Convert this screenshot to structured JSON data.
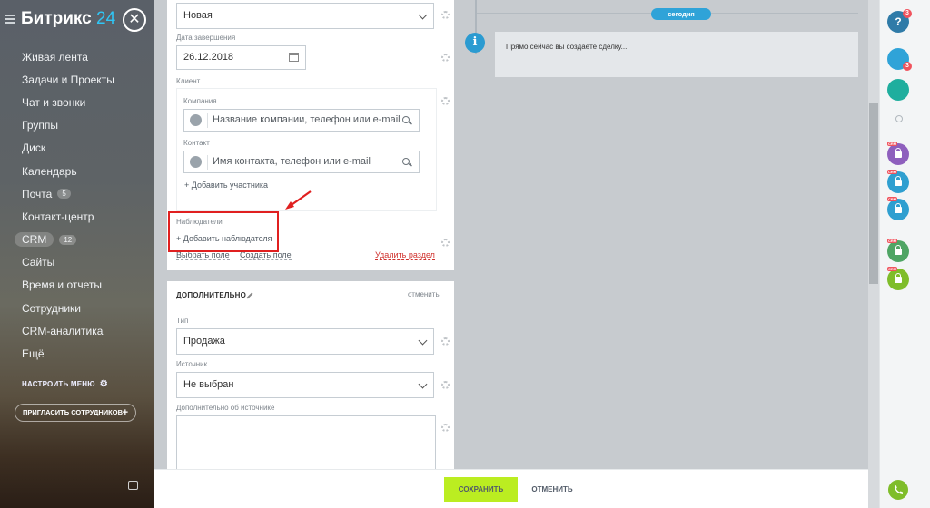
{
  "sidebar": {
    "brand_name": "Битрикс",
    "brand_num": "24",
    "items": [
      {
        "label": "Живая лента"
      },
      {
        "label": "Задачи и Проекты"
      },
      {
        "label": "Чат и звонки"
      },
      {
        "label": "Группы"
      },
      {
        "label": "Диск"
      },
      {
        "label": "Календарь"
      },
      {
        "label": "Почта",
        "count": "5"
      },
      {
        "label": "Контакт-центр"
      },
      {
        "label": "CRM",
        "count": "12"
      },
      {
        "label": "Сайты"
      },
      {
        "label": "Время и отчеты"
      },
      {
        "label": "Сотрудники"
      },
      {
        "label": "CRM-аналитика"
      },
      {
        "label": "Ещё"
      }
    ],
    "setup_menu": "НАСТРОИТЬ МЕНЮ",
    "invite": "ПРИГЛАСИТЬ СОТРУДНИКОВ"
  },
  "form": {
    "stage_value": "Новая",
    "end_date_label": "Дата завершения",
    "end_date_value": "26.12.2018",
    "client_label": "Клиент",
    "company_label": "Компания",
    "company_placeholder": "Название компании, телефон или e-mail",
    "contact_label": "Контакт",
    "contact_placeholder": "Имя контакта, телефон или e-mail",
    "add_participant": "+ Добавить участника",
    "observers_label": "Наблюдатели",
    "add_observer": "+ Добавить наблюдателя",
    "choose_field": "Выбрать поле",
    "create_field": "Создать поле",
    "delete_section": "Удалить раздел",
    "extra_title": "ДОПОЛНИТЕЛЬНО",
    "cancel_section": "отменить",
    "type_label": "Тип",
    "type_value": "Продажа",
    "source_label": "Источник",
    "source_value": "Не выбран",
    "source_extra_label": "Дополнительно об источнике"
  },
  "timeline": {
    "today": "сегодня",
    "message": "Прямо сейчас вы создаёте сделку..."
  },
  "rail": {
    "help_badge": "3",
    "notif_badge": "3",
    "crm_tag": "CRM"
  },
  "actions": {
    "save": "СОХРАНИТЬ",
    "cancel": "ОТМЕНИТЬ"
  },
  "colors": {
    "accent": "#2fc6f6",
    "save_button": "#bbed21",
    "highlight_box": "#e02020",
    "delete_link": "#d0312d"
  }
}
